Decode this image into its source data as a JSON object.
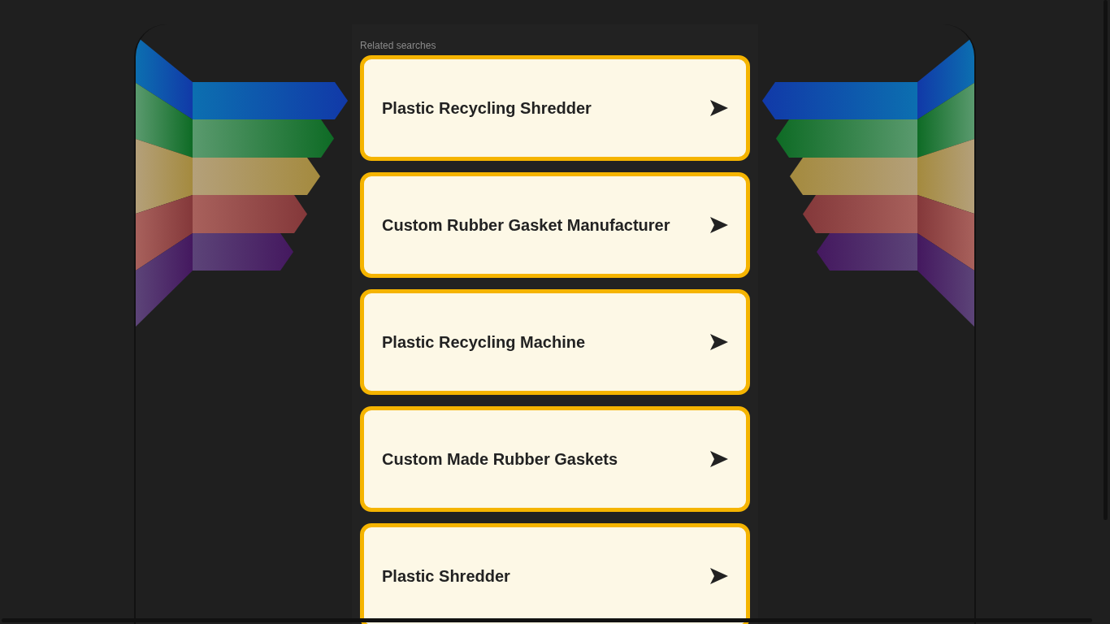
{
  "related_searches": {
    "heading": "Related searches",
    "items": [
      {
        "label": "Plastic Recycling Shredder"
      },
      {
        "label": "Custom Rubber Gasket Manufacturer"
      },
      {
        "label": "Plastic Recycling Machine"
      },
      {
        "label": "Custom Made Rubber Gaskets"
      },
      {
        "label": "Plastic Shredder"
      }
    ]
  }
}
